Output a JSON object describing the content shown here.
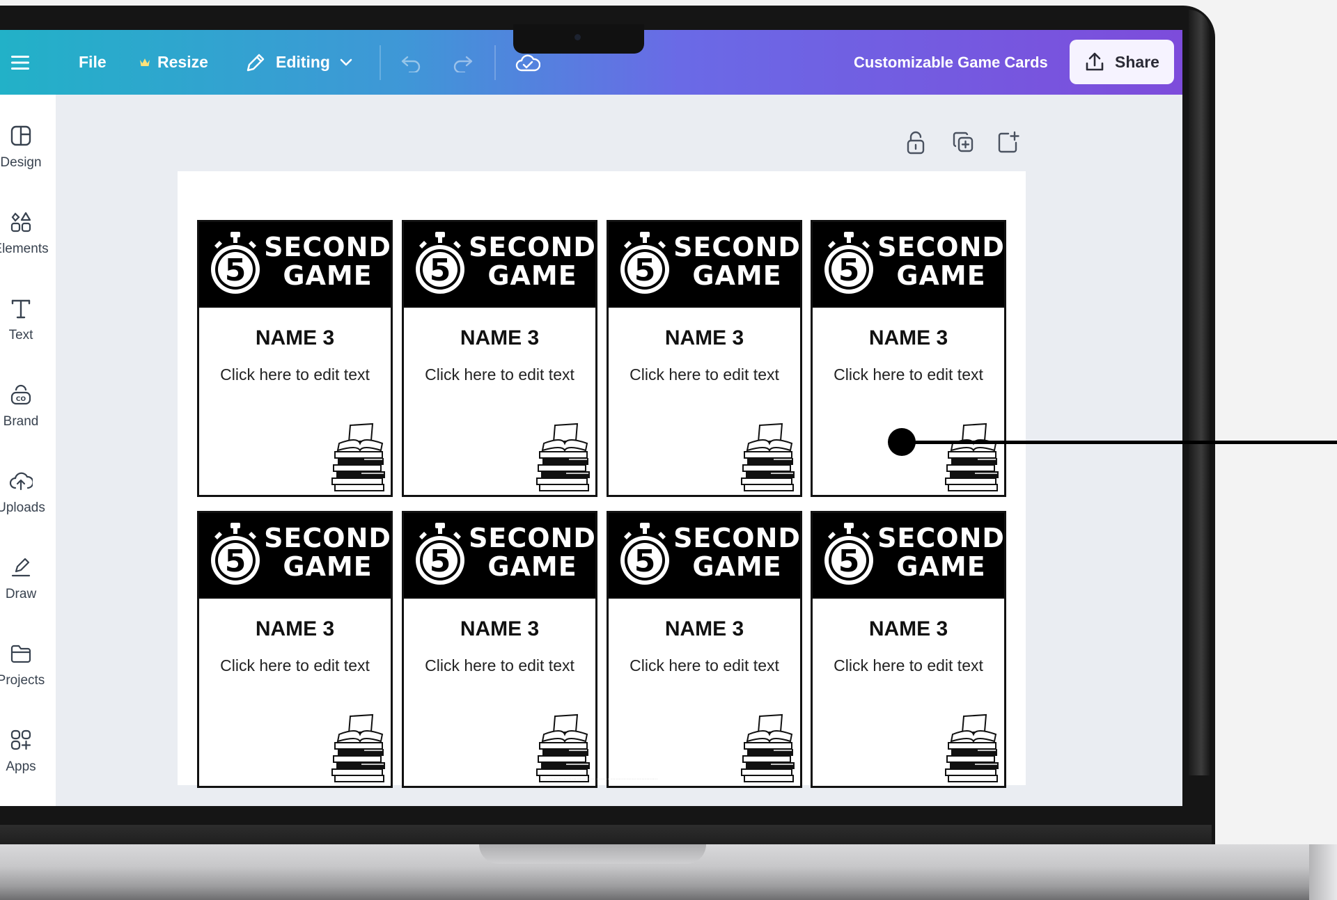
{
  "toolbar": {
    "file_label": "File",
    "resize_label": "Resize",
    "editing_label": "Editing",
    "design_title": "Customizable Game Cards",
    "share_label": "Share",
    "icons": [
      "menu-icon",
      "crown-icon",
      "pencil-icon",
      "chevron-down-icon",
      "undo-icon",
      "redo-icon",
      "cloud-save-icon",
      "upload-icon"
    ]
  },
  "sidebar": {
    "items": [
      {
        "label": "Design",
        "icon": "design-icon"
      },
      {
        "label": "Elements",
        "icon": "elements-icon"
      },
      {
        "label": "Text",
        "icon": "text-icon"
      },
      {
        "label": "Brand",
        "icon": "brand-icon"
      },
      {
        "label": "Uploads",
        "icon": "uploads-icon"
      },
      {
        "label": "Draw",
        "icon": "draw-icon"
      },
      {
        "label": "Projects",
        "icon": "projects-icon"
      },
      {
        "label": "Apps",
        "icon": "apps-icon"
      }
    ]
  },
  "canvas_controls": [
    "lock-icon",
    "duplicate-icon",
    "add-page-icon"
  ],
  "cards": [
    {
      "title_line1": "SECOND",
      "title_line2": "GAME",
      "timer_number": "5",
      "name": "NAME 3",
      "text": "Click here to edit text"
    },
    {
      "title_line1": "SECOND",
      "title_line2": "GAME",
      "timer_number": "5",
      "name": "NAME 3",
      "text": "Click here to edit text"
    },
    {
      "title_line1": "SECOND",
      "title_line2": "GAME",
      "timer_number": "5",
      "name": "NAME 3",
      "text": "Click here to edit text"
    },
    {
      "title_line1": "SECOND",
      "title_line2": "GAME",
      "timer_number": "5",
      "name": "NAME 3",
      "text": "Click here to edit text"
    },
    {
      "title_line1": "SECOND",
      "title_line2": "GAME",
      "timer_number": "5",
      "name": "NAME 3",
      "text": "Click here to edit text"
    },
    {
      "title_line1": "SECOND",
      "title_line2": "GAME",
      "timer_number": "5",
      "name": "NAME 3",
      "text": "Click here to edit text"
    },
    {
      "title_line1": "SECOND",
      "title_line2": "GAME",
      "timer_number": "5",
      "name": "NAME 3",
      "text": "Click here to edit text"
    },
    {
      "title_line1": "SECOND",
      "title_line2": "GAME",
      "timer_number": "5",
      "name": "NAME 3",
      "text": "Click here to edit text"
    }
  ],
  "colors": {
    "toolbar_gradient_start": "#21b2c7",
    "toolbar_gradient_end": "#7d4cdb",
    "card_header": "#000000",
    "canvas_bg": "#eaedf2"
  }
}
